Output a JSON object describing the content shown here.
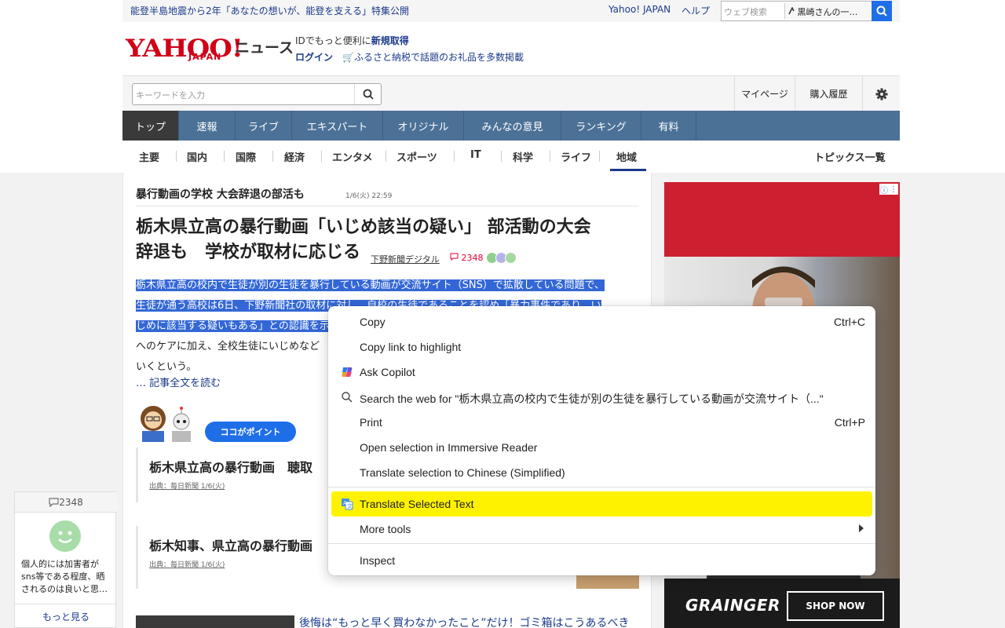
{
  "topbar": {
    "promo": "能登半島地震から2年「あなたの想いが、能登を支える」特集公開",
    "yahoo_japan": "Yahoo! JAPAN",
    "help": "ヘルプ",
    "web_search_placeholder": "ウェブ検索",
    "trend": "黒崎さんの一…"
  },
  "masthead": {
    "logo_yahoo": "YAHOO!",
    "logo_japan": "JAPAN",
    "logo_news": "ニュース",
    "register_prefix": "IDでもっと便利に",
    "register_link": "新規取得",
    "login": "ログイン",
    "furusato": "ふるさと納税で話題のお礼品を多数掲載"
  },
  "search": {
    "placeholder": "キーワードを入力",
    "mypage": "マイページ",
    "history": "購入履歴"
  },
  "gnav": [
    "トップ",
    "速報",
    "ライブ",
    "エキスパート",
    "オリジナル",
    "みんなの意見",
    "ランキング",
    "有料"
  ],
  "subnav": {
    "items": [
      "主要",
      "国内",
      "国際",
      "経済",
      "エンタメ",
      "スポーツ",
      "IT",
      "科学",
      "ライフ",
      "地域"
    ],
    "topics": "トピックス一覧"
  },
  "article": {
    "topic": "暴行動画の学校 大会辞退の部活も",
    "topic_date": "1/6(火) 22:59",
    "headline_1": "栃木県立高の暴行動画「いじめ該当の疑い」 部活動の大会",
    "headline_2": "辞退も　学校が取材に応じる",
    "source": "下野新聞デジタル",
    "comments": "2348",
    "body_1": "栃木県立高の校内で生徒が別の生徒を暴行している動画が交流サイト（SNS）で拡散している問題で、",
    "body_2": "生徒が通う高校は6日、下野新聞社の取材に対し、自校の生徒であることを認め「暴力事件であり、い",
    "body_3": "じめに該当する疑いもある」との認識を示",
    "body_4": "へのケアに加え、全校生徒にいじめなど",
    "body_5": "いくという。",
    "read_more": "… 記事全文を読む",
    "koko_badge": "ココがポイント",
    "related_1_title": "栃木県立高の暴行動画　聴取",
    "related_1_src": "出典：毎日新聞 1/6(火)",
    "related_2_title": "栃木知事、県立高の暴行動画",
    "related_2_src": "出典：毎日新聞 1/6(火)",
    "bottom_link": "後悔は“もっと早く買わなかったこと”だけ！ゴミ箱はこうあるべき"
  },
  "ad": {
    "brand": "GRAINGER",
    "cta": "SHOP NOW"
  },
  "side_widget": {
    "count": "2348",
    "text": "個人的には加害者がsns等である程度、晒されるのは良いと思…",
    "more": "もっと見る"
  },
  "context_menu": {
    "items": [
      {
        "label": "Copy",
        "shortcut": "Ctrl+C"
      },
      {
        "label": "Copy link to highlight",
        "shortcut": ""
      },
      {
        "label": "Ask Copilot",
        "shortcut": ""
      },
      {
        "label": "Search the web for \"栃木県立高の校内で生徒が別の生徒を暴行している動画が交流サイト（...\"",
        "shortcut": ""
      },
      {
        "label": "Print",
        "shortcut": "Ctrl+P"
      },
      {
        "label": "Open selection in Immersive Reader",
        "shortcut": ""
      },
      {
        "label": "Translate selection to Chinese (Simplified)",
        "shortcut": ""
      },
      {
        "label": "Translate Selected Text",
        "shortcut": ""
      },
      {
        "label": "More tools",
        "shortcut": ""
      },
      {
        "label": "Inspect",
        "shortcut": ""
      }
    ],
    "highlight_color": "#fff200"
  },
  "colors": {
    "nav_blue": "#4b7196",
    "brand_red": "#d00018",
    "link_blue": "#1a3a8a",
    "selection_blue": "#3367d6"
  }
}
